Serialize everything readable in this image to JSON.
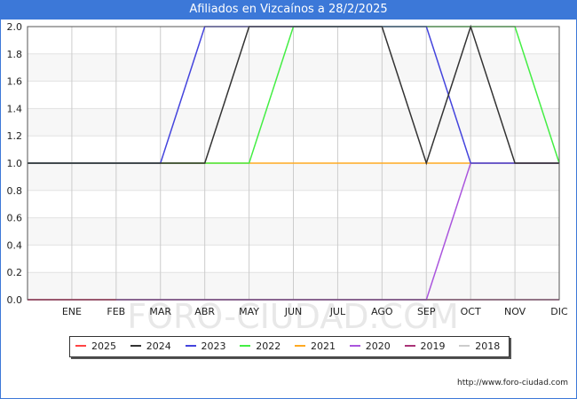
{
  "title": "Afiliados en Vizcaínos a 28/2/2025",
  "footer": "http://www.foro-ciudad.com",
  "watermark": "FORO-CIUDAD.COM",
  "chart_data": {
    "type": "line",
    "categories": [
      "",
      "ENE",
      "FEB",
      "MAR",
      "ABR",
      "MAY",
      "JUN",
      "JUL",
      "AGO",
      "SEP",
      "OCT",
      "NOV",
      "DIC"
    ],
    "ylim": [
      0,
      2.0
    ],
    "yticks": [
      "0.0",
      "0.2",
      "0.4",
      "0.6",
      "0.8",
      "1.0",
      "1.2",
      "1.4",
      "1.6",
      "1.8",
      "2.0"
    ],
    "grid": true,
    "legend_position": "bottom",
    "series": [
      {
        "name": "2025",
        "color": "#ff4444",
        "values": [
          0,
          0,
          0,
          null,
          null,
          null,
          null,
          null,
          null,
          null,
          null,
          null,
          null
        ]
      },
      {
        "name": "2024",
        "color": "#333333",
        "values": [
          1,
          1,
          1,
          1,
          1,
          2,
          2,
          2,
          2,
          1,
          2,
          1,
          1
        ]
      },
      {
        "name": "2023",
        "color": "#4444dd",
        "values": [
          1,
          1,
          1,
          1,
          2,
          2,
          2,
          2,
          2,
          2,
          1,
          1,
          1
        ]
      },
      {
        "name": "2022",
        "color": "#44ee44",
        "values": [
          1,
          1,
          1,
          1,
          1,
          1,
          2,
          2,
          2,
          2,
          2,
          2,
          1
        ]
      },
      {
        "name": "2021",
        "color": "#ffaa22",
        "values": [
          1,
          1,
          1,
          1,
          1,
          1,
          1,
          1,
          1,
          1,
          1,
          1,
          1
        ]
      },
      {
        "name": "2020",
        "color": "#aa55dd",
        "values": [
          0,
          0,
          0,
          0,
          0,
          0,
          0,
          0,
          0,
          0,
          1,
          1,
          1
        ]
      },
      {
        "name": "2019",
        "color": "#aa3377",
        "values": [
          0,
          0,
          0,
          0,
          0,
          0,
          0,
          0,
          0,
          0,
          0,
          0,
          0
        ]
      },
      {
        "name": "2018",
        "color": "#cccccc",
        "values": [
          null,
          null,
          null,
          null,
          null,
          null,
          null,
          null,
          null,
          null,
          null,
          null,
          null
        ]
      }
    ]
  }
}
